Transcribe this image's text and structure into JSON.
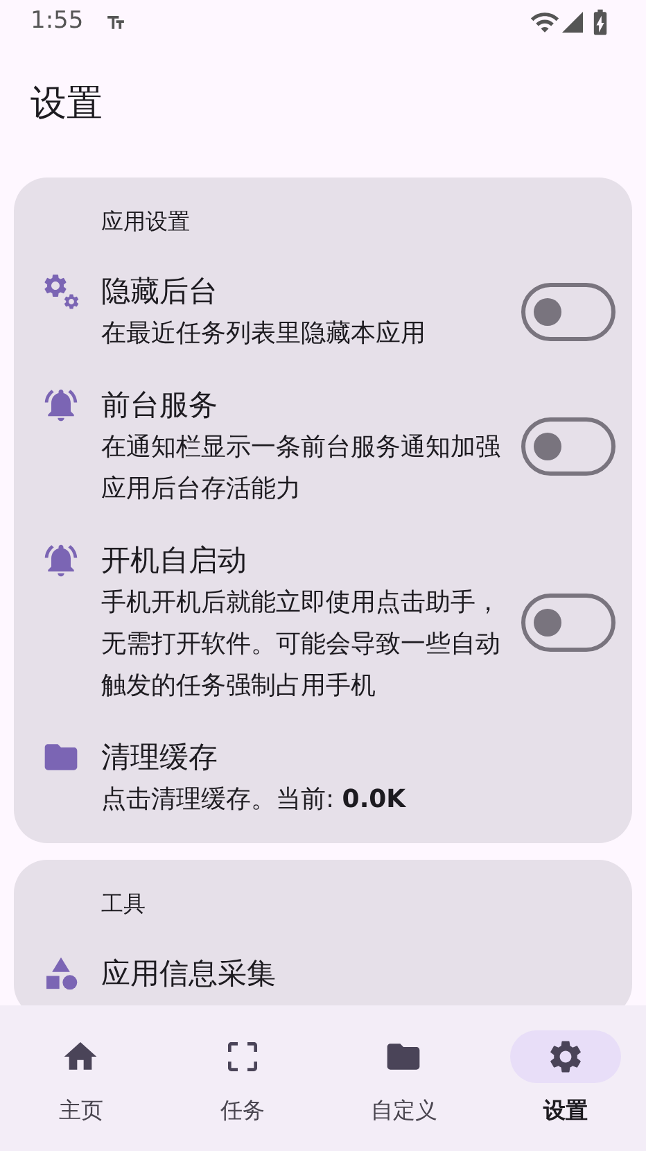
{
  "status_bar": {
    "time": "1:55"
  },
  "title": "设置",
  "sections": [
    {
      "title": "应用设置",
      "items": [
        {
          "kind": "toggle",
          "title": "隐藏后台",
          "subtitle": "在最近任务列表里隐藏本应用",
          "on": false
        },
        {
          "kind": "toggle",
          "title": "前台服务",
          "subtitle": "在通知栏显示一条前台服务通知加强应用后台存活能力",
          "on": false
        },
        {
          "kind": "toggle",
          "title": "开机自启动",
          "subtitle": "手机开机后就能立即使用点击助手，无需打开软件。可能会导致一些自动触发的任务强制占用手机",
          "on": false
        },
        {
          "kind": "info",
          "title": "清理缓存",
          "subtitle": "点击清理缓存。当前: **0.0K**"
        }
      ]
    },
    {
      "title": "工具",
      "items": [
        {
          "kind": "info",
          "title": "应用信息采集"
        }
      ]
    }
  ],
  "nav": [
    {
      "label": "主页",
      "selected": false
    },
    {
      "label": "任务",
      "selected": false
    },
    {
      "label": "自定义",
      "selected": false
    },
    {
      "label": "设置",
      "selected": true
    }
  ]
}
